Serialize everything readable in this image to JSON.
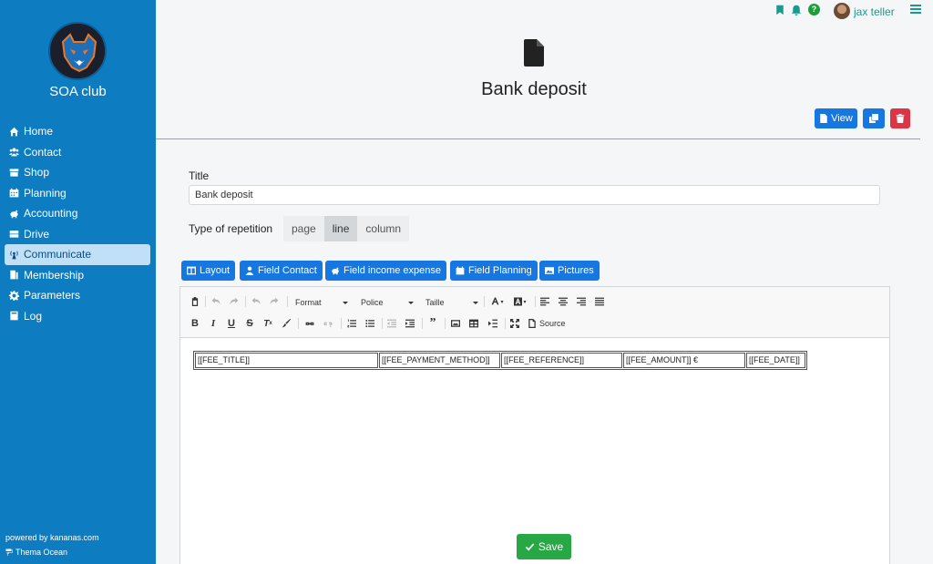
{
  "sidebar": {
    "club_name": "SOA club",
    "items": [
      {
        "label": "Home",
        "icon": "home-icon"
      },
      {
        "label": "Contact",
        "icon": "users-icon"
      },
      {
        "label": "Shop",
        "icon": "store-icon"
      },
      {
        "label": "Planning",
        "icon": "calendar-icon"
      },
      {
        "label": "Accounting",
        "icon": "piggy-bank-icon"
      },
      {
        "label": "Drive",
        "icon": "drive-icon"
      },
      {
        "label": "Communicate",
        "icon": "broadcast-icon"
      },
      {
        "label": "Membership",
        "icon": "membership-icon"
      },
      {
        "label": "Parameters",
        "icon": "gear-icon"
      },
      {
        "label": "Log",
        "icon": "book-icon"
      }
    ],
    "active_item": "Communicate",
    "powered_by": "powered by kananas.com",
    "theme": "Thema Ocean"
  },
  "header": {
    "username": "jax teller",
    "help_label": "?"
  },
  "page": {
    "title": "Bank deposit",
    "view_label": "View"
  },
  "form": {
    "title_label": "Title",
    "title_value": "Bank deposit",
    "repetition_label": "Type of repetition",
    "repetition_options": [
      "page",
      "line",
      "column"
    ],
    "repetition_selected": "line"
  },
  "field_buttons": [
    "Layout",
    "Field Contact",
    "Field income expense",
    "Field Planning",
    "Pictures"
  ],
  "editor": {
    "format_label": "Format",
    "font_label": "Police",
    "size_label": "Taille",
    "source_label": "Source",
    "cells": [
      "[[FEE_TITLE]]",
      "[[FEE_PAYMENT_METHOD]]",
      "[[FEE_REFERENCE]]",
      "[[FEE_AMOUNT]] €",
      "[[FEE_DATE]]"
    ]
  },
  "save_label": "Save",
  "colors": {
    "sidebar": "#0d7cc1",
    "primary": "#1677e0",
    "danger": "#dc3545",
    "success": "#28a745",
    "teal": "#1a9a8e"
  }
}
